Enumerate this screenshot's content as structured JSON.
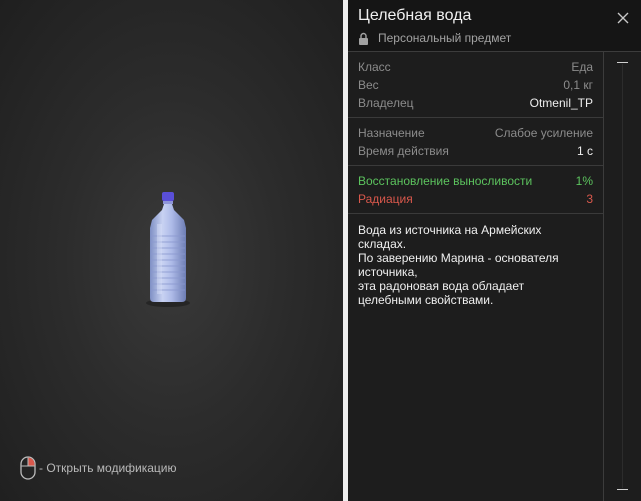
{
  "item": {
    "title": "Целебная вода",
    "subtitle": "Персональный предмет",
    "lock_icon": "lock-icon",
    "close_icon": "close-icon"
  },
  "info": {
    "class_label": "Класс",
    "class_value": "Еда",
    "weight_label": "Вес",
    "weight_value": "0,1 кг",
    "owner_label": "Владелец",
    "owner_value": "Otmenil_TP"
  },
  "usage": {
    "purpose_label": "Назначение",
    "purpose_value": "Слабое усиление",
    "duration_label": "Время действия",
    "duration_value": "1 с"
  },
  "effects": {
    "stamina_label": "Восстановление выносливости",
    "stamina_value": "1%",
    "radiation_label": "Радиация",
    "radiation_value": "3"
  },
  "description": [
    "Вода из источника на Армейских",
    "складах.",
    "По заверению Марина - основателя",
    "источника,",
    "эта радоновая вода обладает",
    "целебными свойствами."
  ],
  "preview": {
    "hint": "- Открыть модификацию",
    "mouse_icon": "mouse-right-click-icon",
    "model": "water-bottle"
  },
  "colors": {
    "positive": "#5cc35e",
    "negative": "#d9584c",
    "cap": "#5a4fd8"
  }
}
